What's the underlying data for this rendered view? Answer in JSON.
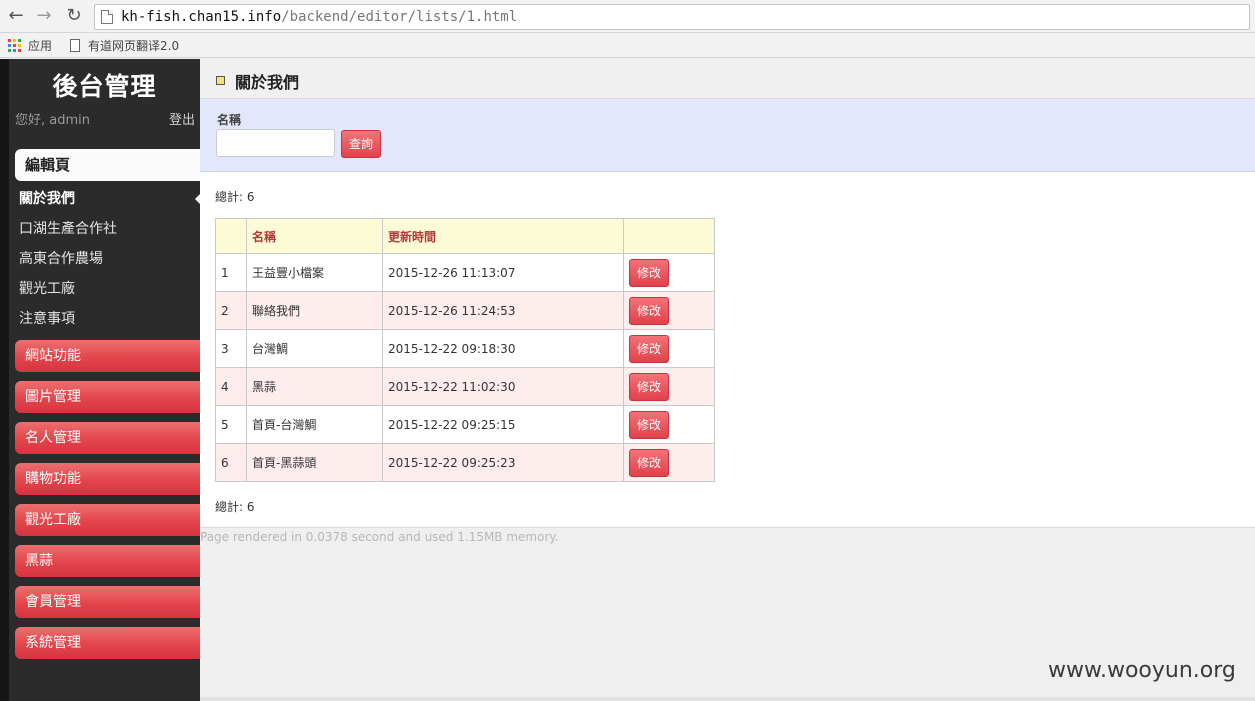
{
  "browser": {
    "url_host": "kh-fish.chan15.info",
    "url_path": "/backend/editor/lists/1.html",
    "bookmarks": [
      "应用",
      "有道网页翻译2.0"
    ]
  },
  "sidebar": {
    "title": "後台管理",
    "greeting": "您好, admin",
    "logout": "登出",
    "section": "編輯頁",
    "sub_items": [
      "關於我們",
      "口湖生產合作社",
      "高東合作農場",
      "觀光工廠",
      "注意事項"
    ],
    "active_sub": "關於我們",
    "menu": [
      "網站功能",
      "圖片管理",
      "名人管理",
      "購物功能",
      "觀光工廠",
      "黑蒜",
      "會員管理",
      "系統管理"
    ]
  },
  "main": {
    "page_title": "關於我們",
    "search": {
      "label": "名稱",
      "value": "",
      "button": "查詢"
    },
    "total_label": "總計:",
    "total": "6",
    "table": {
      "headers": [
        "",
        "名稱",
        "更新時間",
        ""
      ],
      "rows": [
        {
          "no": "1",
          "name": "王益豐小檔案",
          "updated": "2015-12-26 11:13:07",
          "action": "修改"
        },
        {
          "no": "2",
          "name": "聯絡我們",
          "updated": "2015-12-26 11:24:53",
          "action": "修改"
        },
        {
          "no": "3",
          "name": "台灣鯛",
          "updated": "2015-12-22 09:18:30",
          "action": "修改"
        },
        {
          "no": "4",
          "name": "黑蒜",
          "updated": "2015-12-22 11:02:30",
          "action": "修改"
        },
        {
          "no": "5",
          "name": "首頁-台灣鯛",
          "updated": "2015-12-22 09:25:15",
          "action": "修改"
        },
        {
          "no": "6",
          "name": "首頁-黑蒜頭",
          "updated": "2015-12-22 09:25:23",
          "action": "修改"
        }
      ]
    }
  },
  "footer": "Page rendered in 0.0378 second and used 1.15MB memory.",
  "watermark": "www.wooyun.org",
  "colors": {
    "accent_red": "#e3454b",
    "sidebar_bg": "#2b2b2b",
    "search_bg": "#e3e7fb",
    "table_header_bg": "#fdfbd6",
    "row_alt_bg": "#fdeeed"
  }
}
